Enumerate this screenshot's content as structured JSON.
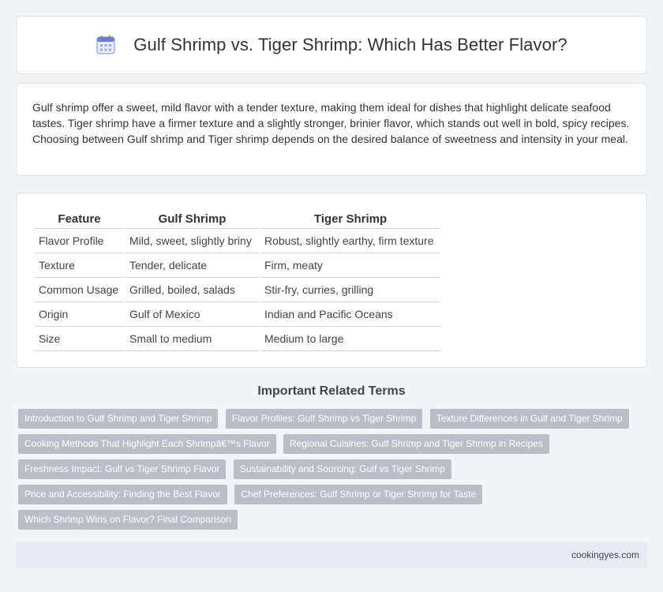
{
  "header": {
    "icon": "calendar-icon",
    "title": "Gulf Shrimp vs. Tiger Shrimp: Which Has Better Flavor?"
  },
  "intro": {
    "text": "Gulf shrimp offer a sweet, mild flavor with a tender texture, making them ideal for dishes that highlight delicate seafood tastes. Tiger shrimp have a firmer texture and a slightly stronger, brinier flavor, which stands out well in bold, spicy recipes. Choosing between Gulf shrimp and Tiger shrimp depends on the desired balance of sweetness and intensity in your meal."
  },
  "comparison": {
    "headers": [
      "Feature",
      "Gulf Shrimp",
      "Tiger Shrimp"
    ],
    "rows": [
      [
        "Flavor Profile",
        "Mild, sweet, slightly briny",
        "Robust, slightly earthy, firm texture"
      ],
      [
        "Texture",
        "Tender, delicate",
        "Firm, meaty"
      ],
      [
        "Common Usage",
        "Grilled, boiled, salads",
        "Stir-fry, curries, grilling"
      ],
      [
        "Origin",
        "Gulf of Mexico",
        "Indian and Pacific Oceans"
      ],
      [
        "Size",
        "Small to medium",
        "Medium to large"
      ]
    ]
  },
  "related": {
    "heading": "Important Related Terms",
    "tags": [
      "Introduction to Gulf Shrimp and Tiger Shrimp",
      "Flavor Profiles: Gulf Shrimp vs Tiger Shrimp",
      "Texture Differences in Gulf and Tiger Shrimp",
      "Cooking Methods That Highlight Each Shrimpâ€™s Flavor",
      "Regional Cuisines: Gulf Shrimp and Tiger Shrimp in Recipes",
      "Freshness Impact: Gulf vs Tiger Shrimp Flavor",
      "Sustainability and Sourcing: Gulf vs Tiger Shrimp",
      "Price and Accessibility: Finding the Best Flavor",
      "Chef Preferences: Gulf Shrimp or Tiger Shrimp for Taste",
      "Which Shrimp Wins on Flavor? Final Comparison"
    ]
  },
  "footer": {
    "site": "cookingyes.com"
  },
  "colors": {
    "page_bg": "#f3f4f8",
    "tag_bg": "#b9bec8",
    "footer_bg": "#e7eaf5",
    "icon_accent": "#6a7fd6"
  }
}
